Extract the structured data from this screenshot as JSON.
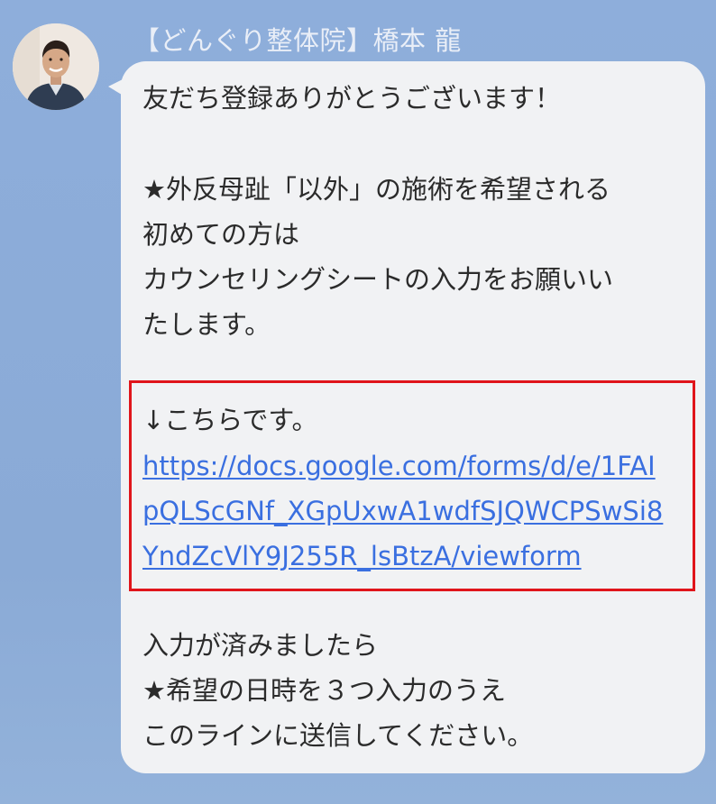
{
  "sender": {
    "name": "【どんぐり整体院】橋本 龍"
  },
  "message": {
    "line_1": "友だち登録ありがとうございます！",
    "line_2": "★外反母趾「以外」の施術を希望される",
    "line_3": "初めての方は",
    "line_4": "カウンセリングシートの入力をお願いい",
    "line_5": "たします。",
    "link_intro": "↓こちらです。",
    "link_line_1": "https://docs.google.com/forms/d/e/1FAI",
    "link_line_2": "pQLScGNf_XGpUxwA1wdfSJQWCPSwSi8",
    "link_line_3": "YndZcVlY9J255R_lsBtzA/viewform",
    "line_after_1": "入力が済みましたら",
    "line_after_2": "★希望の日時を３つ入力のうえ",
    "line_after_3": "このラインに送信してください。"
  },
  "colors": {
    "background": "#8daed9",
    "bubble": "#f1f2f4",
    "link": "#3a6fe0",
    "highlight_border": "#e0151b"
  }
}
